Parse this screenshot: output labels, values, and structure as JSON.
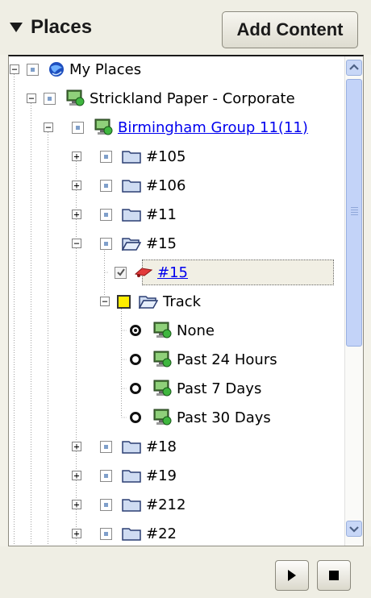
{
  "header": {
    "title": "Places",
    "add_button": "Add Content"
  },
  "tree": {
    "nodes": [
      {
        "label": "My Places"
      },
      {
        "label": "Strickland Paper - Corporate"
      },
      {
        "label": "Birmingham Group 11(11)"
      },
      {
        "label": "#105"
      },
      {
        "label": "#106"
      },
      {
        "label": "#11"
      },
      {
        "label": "#15"
      },
      {
        "label": "#15"
      },
      {
        "label": "Track"
      },
      {
        "label": "None"
      },
      {
        "label": "Past 24 Hours"
      },
      {
        "label": "Past 7 Days"
      },
      {
        "label": "Past 30 Days"
      },
      {
        "label": "#18"
      },
      {
        "label": "#19"
      },
      {
        "label": "#212"
      },
      {
        "label": "#22"
      }
    ],
    "track_selected": "None"
  },
  "footer": {
    "play_icon": "play-icon",
    "stop_icon": "stop-icon"
  }
}
